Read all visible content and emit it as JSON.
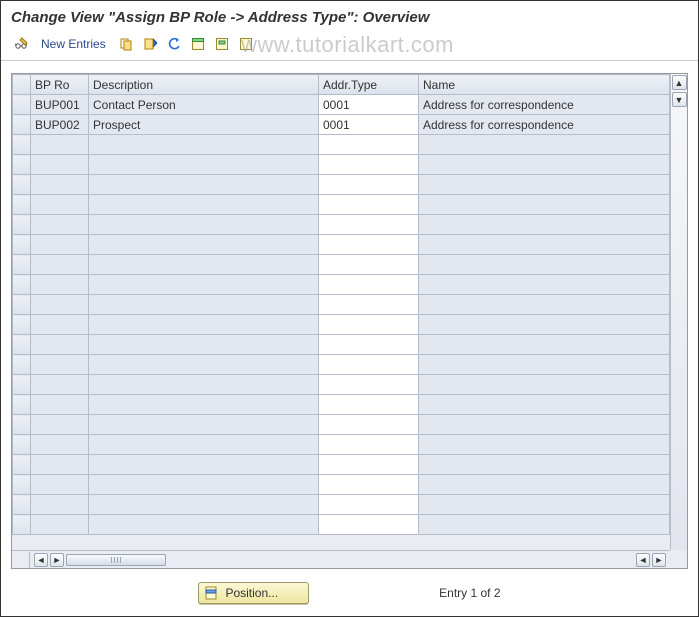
{
  "title": "Change View \"Assign BP Role -> Address Type\": Overview",
  "toolbar": {
    "new_entries_label": "New Entries"
  },
  "watermark": "www.tutorialkart.com",
  "columns": {
    "bp_role": "BP Ro",
    "description": "Description",
    "addr_type": "Addr.Type",
    "name": "Name"
  },
  "rows": [
    {
      "bp_role": "BUP001",
      "description": "Contact Person",
      "addr_type": "0001",
      "name": "Address for correspondence"
    },
    {
      "bp_role": "BUP002",
      "description": "Prospect",
      "addr_type": "0001",
      "name": "Address for correspondence"
    }
  ],
  "footer": {
    "position_label": "Position...",
    "entry_text": "Entry 1 of 2"
  },
  "icons": {
    "toggle": "toggle-icon",
    "copy": "copy-icon",
    "save": "save-icon",
    "undo": "undo-icon",
    "select_all": "select-all-icon",
    "select_block": "select-block-icon",
    "deselect": "deselect-icon",
    "config": "table-settings-icon",
    "position": "position-icon"
  }
}
